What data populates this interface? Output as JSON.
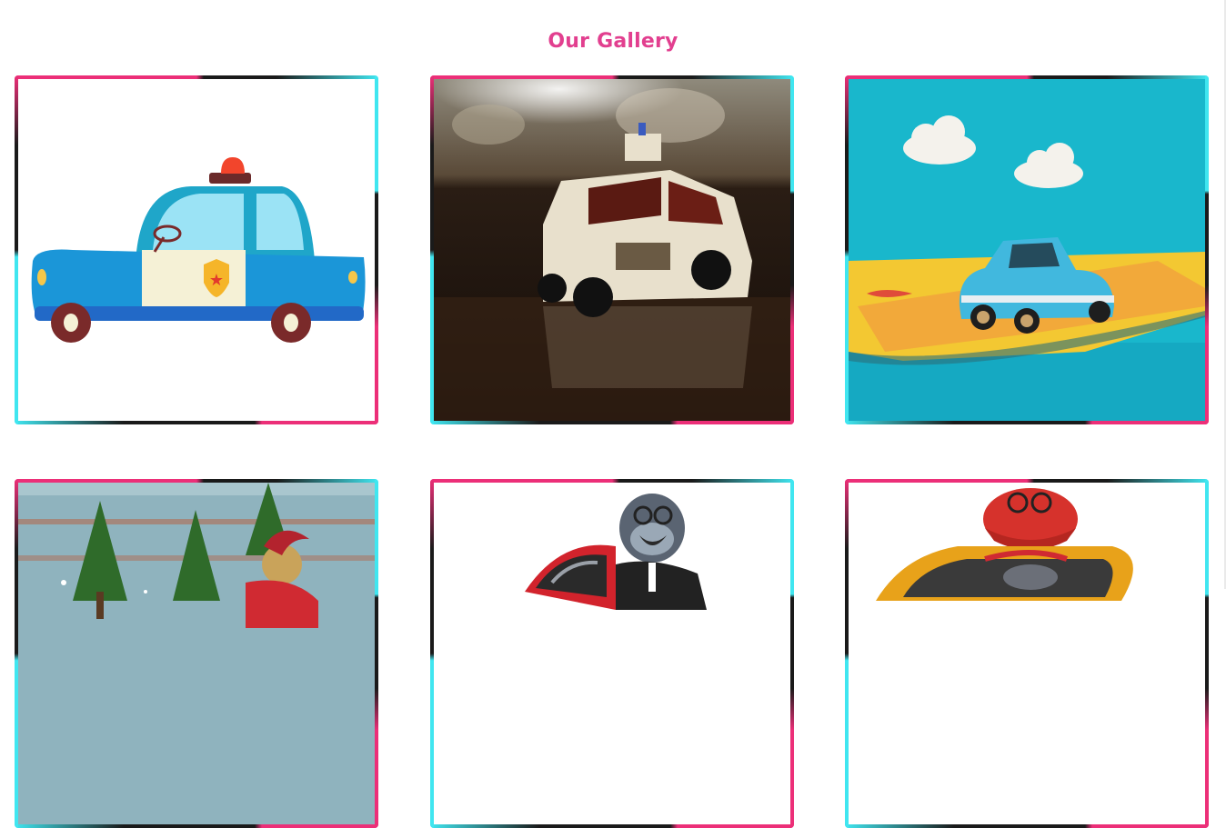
{
  "gallery": {
    "title": "Our Gallery",
    "items": [
      {
        "name": "police-car-cartoon",
        "icon": "police-car-icon"
      },
      {
        "name": "toy-police-car-photo",
        "icon": "toy-car-photo"
      },
      {
        "name": "blue-toy-car-photo",
        "icon": "toy-car-photo"
      },
      {
        "name": "christmas-trees-photo",
        "icon": "christmas-photo"
      },
      {
        "name": "gorilla-driver-cartoon",
        "icon": "gorilla-cartoon"
      },
      {
        "name": "dinosaur-driver-cartoon",
        "icon": "dinosaur-cartoon"
      }
    ]
  },
  "colors": {
    "accent": "#e23f8f",
    "frame_pink": "#ec2f78",
    "frame_cyan": "#40e6f0",
    "frame_dark": "#1a1a1a"
  }
}
